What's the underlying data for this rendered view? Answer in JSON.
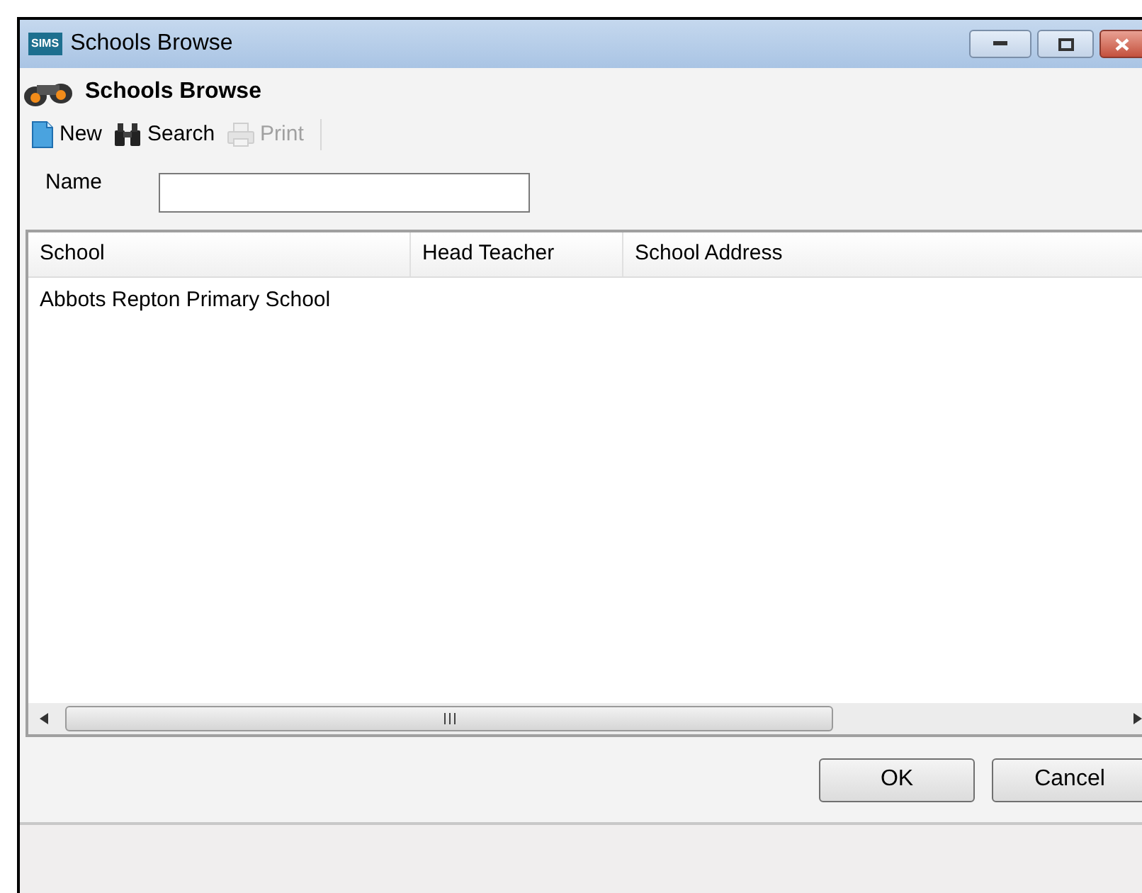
{
  "window": {
    "title": "Schools Browse",
    "app_badge": "SIMS"
  },
  "header": {
    "title": "Schools Browse"
  },
  "toolbar": [
    {
      "label": "New",
      "kind": "new",
      "disabled": false
    },
    {
      "label": "Search",
      "kind": "search",
      "disabled": false
    },
    {
      "label": "Print",
      "kind": "print",
      "disabled": true
    }
  ],
  "search": {
    "label": "Name"
  },
  "table": {
    "columns": [
      "School",
      "Head Teacher",
      "School Address"
    ],
    "rows": [
      [
        "Abbots Repton Primary School",
        "",
        ""
      ]
    ]
  },
  "buttons": [
    "OK",
    "Cancel"
  ]
}
